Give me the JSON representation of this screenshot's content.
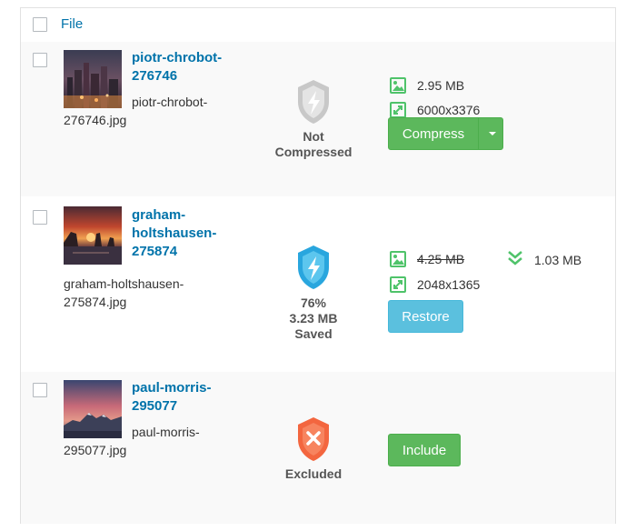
{
  "header": {
    "column_label": "File"
  },
  "rows": [
    {
      "title": "piotr-chrobot-276746",
      "title_lines": [
        "piotr-chrobot-",
        "276746"
      ],
      "filename_lines": [
        "piotr-chrobot-",
        "276746.jpg"
      ],
      "status": "not-compressed",
      "status_lines": [
        "Not",
        "Compressed"
      ],
      "size": "2.95 MB",
      "dimensions": "6000x3376",
      "button_label": "Compress"
    },
    {
      "title": "graham-holtshausen-275874",
      "title_lines": [
        "graham-",
        "holtshausen-",
        "275874"
      ],
      "filename_lines": [
        "graham-holtshausen-",
        "275874.jpg"
      ],
      "status": "compressed",
      "status_lines": [
        "76%",
        "3.23 MB",
        "Saved"
      ],
      "original_size": "4.25 MB",
      "compressed_size": "1.03 MB",
      "dimensions": "2048x1365",
      "button_label": "Restore"
    },
    {
      "title": "paul-morris-295077",
      "title_lines": [
        "paul-morris-",
        "295077"
      ],
      "filename_lines": [
        "paul-morris-",
        "295077.jpg"
      ],
      "status": "excluded",
      "status_lines": [
        "Excluded"
      ],
      "button_label": "Include"
    }
  ],
  "colors": {
    "link": "#0073aa",
    "success_green": "#5cb85c",
    "info_blue": "#5bc0de",
    "excluded_orange": "#f3663f",
    "shield_grey": "#c8c8c8",
    "meta_icon_green": "#4fc36a"
  },
  "icons": {
    "size": "image-icon",
    "dimensions": "resize-icon",
    "savings": "double-chevron-down-icon",
    "split": "caret-down-icon"
  }
}
